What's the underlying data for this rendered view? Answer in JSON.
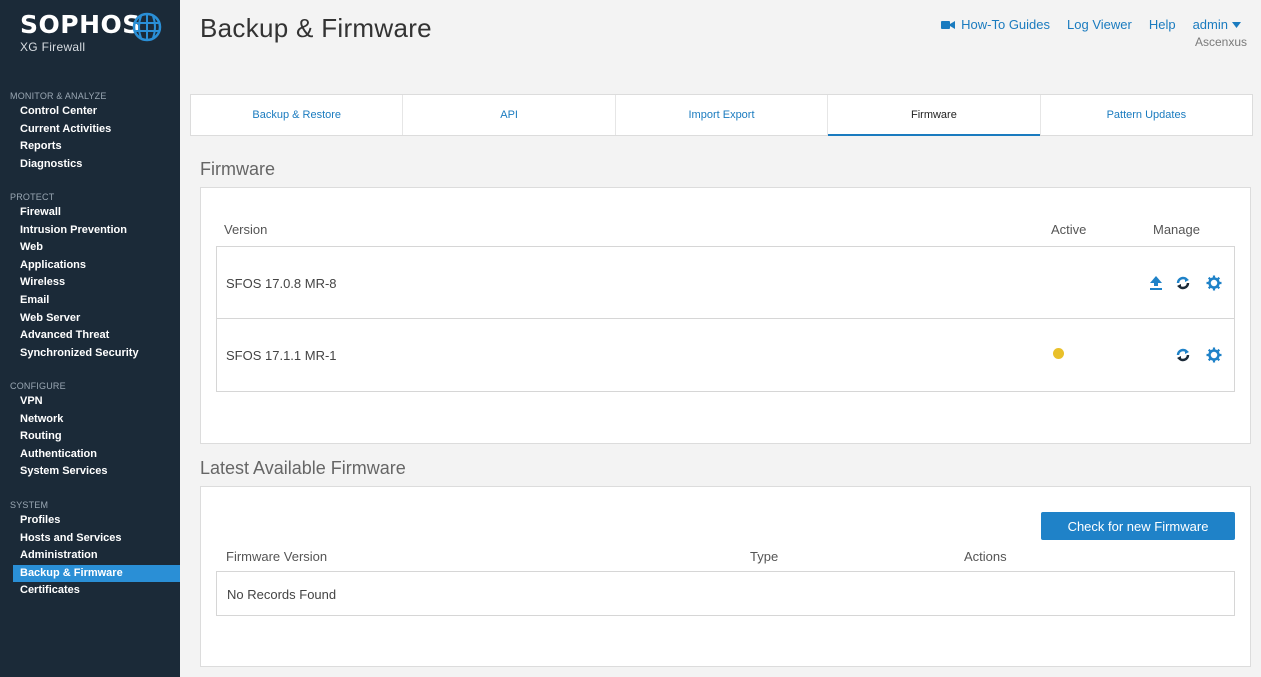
{
  "brand": {
    "name": "SOPHOS",
    "product": "XG Firewall"
  },
  "sidebar": {
    "sections": [
      {
        "heading": "MONITOR & ANALYZE",
        "items": [
          "Control Center",
          "Current Activities",
          "Reports",
          "Diagnostics"
        ]
      },
      {
        "heading": "PROTECT",
        "items": [
          "Firewall",
          "Intrusion Prevention",
          "Web",
          "Applications",
          "Wireless",
          "Email",
          "Web Server",
          "Advanced Threat",
          "Synchronized Security"
        ]
      },
      {
        "heading": "CONFIGURE",
        "items": [
          "VPN",
          "Network",
          "Routing",
          "Authentication",
          "System Services"
        ]
      },
      {
        "heading": "SYSTEM",
        "items": [
          "Profiles",
          "Hosts and Services",
          "Administration",
          "Backup & Firmware",
          "Certificates"
        ]
      }
    ],
    "active_item": "Backup & Firmware"
  },
  "header": {
    "title": "Backup & Firmware",
    "links": {
      "howto": "How-To Guides",
      "logviewer": "Log Viewer",
      "help": "Help",
      "admin": "admin"
    },
    "org": "Ascenxus"
  },
  "tabs": [
    {
      "label": "Backup & Restore",
      "active": false
    },
    {
      "label": "API",
      "active": false
    },
    {
      "label": "Import Export",
      "active": false
    },
    {
      "label": "Firmware",
      "active": true
    },
    {
      "label": "Pattern Updates",
      "active": false
    }
  ],
  "firmware": {
    "title": "Firmware",
    "columns": {
      "version": "Version",
      "active": "Active",
      "manage": "Manage"
    },
    "rows": [
      {
        "version": "SFOS 17.0.8 MR-8",
        "active": false,
        "actions": [
          "upload-icon",
          "refresh-icon",
          "gear-icon"
        ]
      },
      {
        "version": "SFOS 17.1.1 MR-1",
        "active": true,
        "actions": [
          "refresh-icon",
          "gear-icon"
        ]
      }
    ]
  },
  "latest": {
    "title": "Latest Available Firmware",
    "check_button": "Check for new Firmware",
    "columns": {
      "version": "Firmware Version",
      "type": "Type",
      "actions": "Actions"
    },
    "empty_text": "No Records Found"
  },
  "colors": {
    "sidebar": "#1b2a38",
    "accent": "#1f82c8",
    "active_dot": "#e9c02a"
  }
}
